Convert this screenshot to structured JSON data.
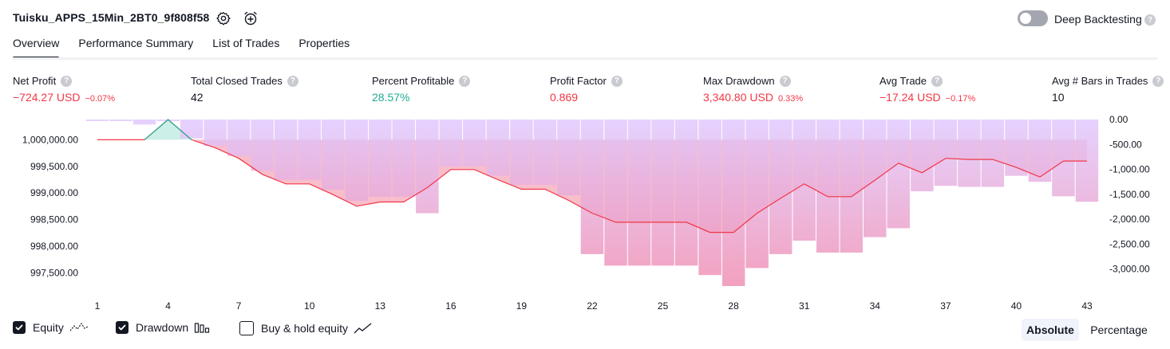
{
  "header": {
    "strategy_name": "Tuisku_APPS_15Min_2BT0_9f808f58",
    "settings_icon": "gear-icon",
    "alert_icon": "alarm-clock-plus-icon",
    "deep_backtesting_label": "Deep Backtesting",
    "deep_backtesting_enabled": false
  },
  "tabs": [
    {
      "label": "Overview",
      "active": true
    },
    {
      "label": "Performance Summary",
      "active": false
    },
    {
      "label": "List of Trades",
      "active": false
    },
    {
      "label": "Properties",
      "active": false
    }
  ],
  "metrics": [
    {
      "label": "Net Profit",
      "value": "−724.27 USD",
      "pct": "−0.07%",
      "tone": "neg"
    },
    {
      "label": "Total Closed Trades",
      "value": "42",
      "pct": "",
      "tone": "plain"
    },
    {
      "label": "Percent Profitable",
      "value": "28.57%",
      "pct": "",
      "tone": "pos"
    },
    {
      "label": "Profit Factor",
      "value": "0.869",
      "pct": "",
      "tone": "neg"
    },
    {
      "label": "Max Drawdown",
      "value": "3,340.80 USD",
      "pct": "0.33%",
      "tone": "neg"
    },
    {
      "label": "Avg Trade",
      "value": "−17.24 USD",
      "pct": "−0.17%",
      "tone": "neg"
    },
    {
      "label": "Avg # Bars in Trades",
      "value": "10",
      "pct": "",
      "tone": "plain"
    }
  ],
  "chart_data": {
    "type": "line",
    "x_ticks": [
      "1",
      "4",
      "7",
      "10",
      "13",
      "16",
      "19",
      "22",
      "25",
      "28",
      "31",
      "34",
      "37",
      "40",
      "43"
    ],
    "left_ticks": [
      "1,000,000.00",
      "999,500.00",
      "999,000.00",
      "998,500.00",
      "998,000.00",
      "997,500.00"
    ],
    "left_ylim": [
      997250,
      1000380
    ],
    "right_ticks": [
      "0.00",
      "-500.00",
      "-1,000.00",
      "-1,500.00",
      "-2,000.00",
      "-2,500.00",
      "-3,000.00"
    ],
    "right_ylim": [
      -3340.8,
      0
    ],
    "x": [
      1,
      2,
      3,
      4,
      5,
      6,
      7,
      8,
      9,
      10,
      11,
      12,
      13,
      14,
      15,
      16,
      17,
      18,
      19,
      20,
      21,
      22,
      23,
      24,
      25,
      26,
      27,
      28,
      29,
      30,
      31,
      32,
      33,
      34,
      35,
      36,
      37,
      38,
      39,
      40,
      41,
      42,
      43
    ],
    "series": [
      {
        "name": "Equity",
        "values": [
          1000000,
          1000000,
          1000000,
          1000380,
          1000000,
          999850,
          999650,
          999350,
          999170,
          999170,
          998970,
          998750,
          998830,
          998830,
          999100,
          999440,
          999440,
          999250,
          999070,
          999070,
          998860,
          998620,
          998450,
          998450,
          998450,
          998450,
          998260,
          998260,
          998620,
          998900,
          999170,
          998930,
          998930,
          999240,
          999560,
          999380,
          999650,
          999630,
          999630,
          999480,
          999300,
          999600,
          999600
        ]
      },
      {
        "name": "Drawdown",
        "values": [
          0,
          0,
          -100,
          0,
          -380,
          -530,
          -730,
          -1030,
          -1210,
          -1210,
          -1410,
          -1630,
          -1550,
          -1550,
          -1880,
          -940,
          -940,
          -1130,
          -1310,
          -1310,
          -1520,
          -2700,
          -2930,
          -2930,
          -2930,
          -2930,
          -3120,
          -3340.8,
          -2980,
          -2700,
          -2430,
          -2670,
          -2670,
          -2360,
          -2180,
          -1440,
          -1330,
          -1350,
          -1350,
          -1130,
          -1250,
          -1540,
          -1650
        ]
      }
    ]
  },
  "legend": [
    {
      "label": "Equity",
      "checked": true,
      "icon": "equity-line-icon"
    },
    {
      "label": "Drawdown",
      "checked": true,
      "icon": "drawdown-bars-icon"
    },
    {
      "label": "Buy & hold equity",
      "checked": false,
      "icon": "buy-hold-line-icon"
    }
  ],
  "view_modes": [
    {
      "label": "Absolute",
      "active": true
    },
    {
      "label": "Percentage",
      "active": false
    }
  ]
}
